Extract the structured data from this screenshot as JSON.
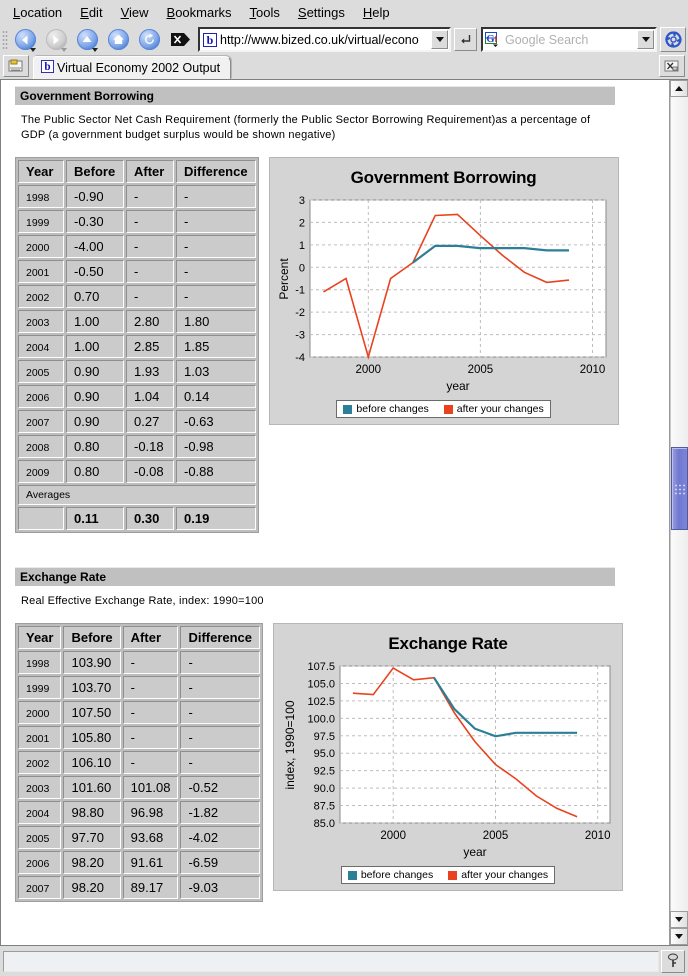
{
  "window": {
    "menubar": [
      {
        "label": "Location",
        "accel": "L"
      },
      {
        "label": "Edit",
        "accel": "E"
      },
      {
        "label": "View",
        "accel": "V"
      },
      {
        "label": "Bookmarks",
        "accel": "B"
      },
      {
        "label": "Tools",
        "accel": "T"
      },
      {
        "label": "Settings",
        "accel": "S"
      },
      {
        "label": "Help",
        "accel": "H"
      }
    ],
    "toolbar": {
      "back": "back-icon",
      "forward": "forward-icon",
      "up": "up-icon",
      "home": "home-icon",
      "reload": "reload-icon",
      "stop": "stop-icon",
      "go": "go-icon",
      "konqueror": "konqueror-gear-icon"
    },
    "url": {
      "value": "http://www.bized.co.uk/virtual/econo",
      "favicon": "bized-b-icon"
    },
    "search": {
      "placeholder": "Google Search",
      "engine_icon": "google-g-icon"
    },
    "tabs": [
      {
        "label": "Virtual Economy 2002 Output",
        "favicon": "bized-b-icon",
        "active": true
      }
    ],
    "tab_tools": {
      "left": "tab-list-icon",
      "right": "tab-close-icon"
    },
    "statusbar": {
      "text": "",
      "icon": "secure-key-icon"
    },
    "scrollbar": {
      "up": "arrow-up-icon",
      "down": "arrow-down-icon",
      "thumb_top_pct": 43,
      "thumb_height_pct": 10
    }
  },
  "colors": {
    "before_changes": "#2b7f96",
    "after_changes": "#e8431e",
    "section_header_bg": "#c0c0c0",
    "chart_bg": "#d4d4d4",
    "scroll_thumb": "#7c85d8"
  },
  "sections": [
    {
      "id": "government-borrowing",
      "heading": "Government Borrowing",
      "description": "The Public Sector Net Cash Requirement (formerly the Public Sector Borrowing Requirement)as a percentage of GDP (a government budget surplus would be shown negative)",
      "table": {
        "columns": [
          "Year",
          "Before",
          "After",
          "Difference"
        ],
        "rows": [
          [
            "1998",
            "-0.90",
            "-",
            "-"
          ],
          [
            "1999",
            "-0.30",
            "-",
            "-"
          ],
          [
            "2000",
            "-4.00",
            "-",
            "-"
          ],
          [
            "2001",
            "-0.50",
            "-",
            "-"
          ],
          [
            "2002",
            "0.70",
            "-",
            "-"
          ],
          [
            "2003",
            "1.00",
            "2.80",
            "1.80"
          ],
          [
            "2004",
            "1.00",
            "2.85",
            "1.85"
          ],
          [
            "2005",
            "0.90",
            "1.93",
            "1.03"
          ],
          [
            "2006",
            "0.90",
            "1.04",
            "0.14"
          ],
          [
            "2007",
            "0.90",
            "0.27",
            "-0.63"
          ],
          [
            "2008",
            "0.80",
            "-0.18",
            "-0.98"
          ],
          [
            "2009",
            "0.80",
            "-0.08",
            "-0.88"
          ]
        ],
        "averages_label": "Averages",
        "averages": [
          "",
          "0.11",
          "0.30",
          "0.19"
        ]
      }
    },
    {
      "id": "exchange-rate",
      "heading": "Exchange Rate",
      "description": "Real Effective Exchange Rate, index: 1990=100",
      "table": {
        "columns": [
          "Year",
          "Before",
          "After",
          "Difference"
        ],
        "rows": [
          [
            "1998",
            "103.90",
            "-",
            "-"
          ],
          [
            "1999",
            "103.70",
            "-",
            "-"
          ],
          [
            "2000",
            "107.50",
            "-",
            "-"
          ],
          [
            "2001",
            "105.80",
            "-",
            "-"
          ],
          [
            "2002",
            "106.10",
            "-",
            "-"
          ],
          [
            "2003",
            "101.60",
            "101.08",
            "-0.52"
          ],
          [
            "2004",
            "98.80",
            "96.98",
            "-1.82"
          ],
          [
            "2005",
            "97.70",
            "93.68",
            "-4.02"
          ],
          [
            "2006",
            "98.20",
            "91.61",
            "-6.59"
          ],
          [
            "2007",
            "98.20",
            "89.17",
            "-9.03"
          ]
        ]
      }
    }
  ],
  "chart_data": [
    {
      "id": "government-borrowing-chart",
      "type": "line",
      "title": "Government Borrowing",
      "xlabel": "year",
      "ylabel": "Percent",
      "xlim": [
        1997.4,
        2010.6
      ],
      "ylim": [
        -4,
        3
      ],
      "xticks": [
        2000,
        2005,
        2010
      ],
      "yticks": [
        -4,
        -3,
        -2,
        -1,
        0,
        1,
        2,
        3
      ],
      "grid": true,
      "legend_position": "bottom",
      "x": [
        1998,
        1999,
        2000,
        2001,
        2002,
        2003,
        2004,
        2005,
        2006,
        2007,
        2008,
        2009
      ],
      "series": [
        {
          "name": "before changes",
          "color": "#2b7f96",
          "x": [
            2002,
            2003,
            2004,
            2005,
            2006,
            2007,
            2008,
            2009
          ],
          "values": [
            0.7,
            1.0,
            1.0,
            0.9,
            0.9,
            0.9,
            0.8,
            0.8
          ]
        },
        {
          "name": "after your changes",
          "color": "#e8431e",
          "x": [
            1998,
            1999,
            2000,
            2001,
            2002,
            2003,
            2004,
            2005,
            2006,
            2007,
            2008,
            2009
          ],
          "values": [
            -0.9,
            -0.3,
            -4.0,
            -0.5,
            0.7,
            2.8,
            2.85,
            1.93,
            1.04,
            0.27,
            -0.18,
            -0.08
          ]
        }
      ]
    },
    {
      "id": "exchange-rate-chart",
      "type": "line",
      "title": "Exchange Rate",
      "xlabel": "year",
      "ylabel": "index, 1990=100",
      "xlim": [
        1997.4,
        2010.6
      ],
      "ylim": [
        85.0,
        107.5
      ],
      "xticks": [
        2000,
        2005,
        2010
      ],
      "yticks": [
        85.0,
        87.5,
        90.0,
        92.5,
        95.0,
        97.5,
        100.0,
        102.5,
        105.0,
        107.5
      ],
      "grid": true,
      "legend_position": "bottom",
      "x": [
        1998,
        1999,
        2000,
        2001,
        2002,
        2003,
        2004,
        2005,
        2006,
        2007,
        2008,
        2009
      ],
      "series": [
        {
          "name": "before changes",
          "color": "#2b7f96",
          "x": [
            2002,
            2003,
            2004,
            2005,
            2006,
            2007,
            2008,
            2009
          ],
          "values": [
            106.1,
            101.6,
            98.8,
            97.7,
            98.2,
            98.2,
            98.2,
            98.2
          ]
        },
        {
          "name": "after your changes",
          "color": "#e8431e",
          "x": [
            1998,
            1999,
            2000,
            2001,
            2002,
            2003,
            2004,
            2005,
            2006,
            2007,
            2008,
            2009
          ],
          "values": [
            103.9,
            103.7,
            107.5,
            105.8,
            106.1,
            101.08,
            96.98,
            93.68,
            91.61,
            89.17,
            87.4,
            86.2
          ]
        }
      ]
    }
  ],
  "legend": {
    "before": "before changes",
    "after": "after your changes"
  }
}
